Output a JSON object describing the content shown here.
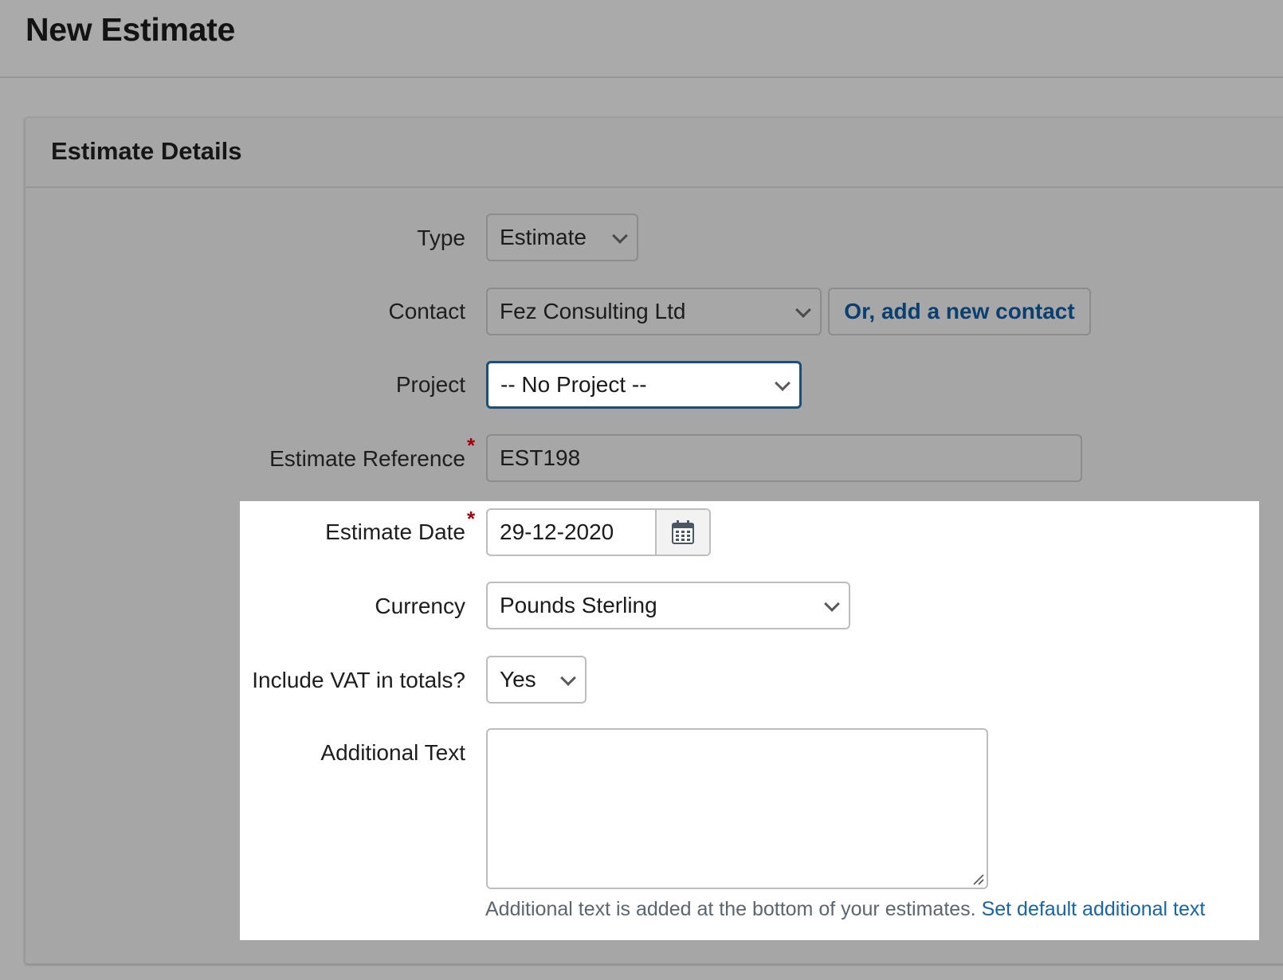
{
  "page": {
    "title": "New Estimate"
  },
  "panel": {
    "title": "Estimate Details"
  },
  "form": {
    "type": {
      "label": "Type",
      "value": "Estimate"
    },
    "contact": {
      "label": "Contact",
      "value": "Fez Consulting Ltd",
      "add_label": "Or, add a new contact"
    },
    "project": {
      "label": "Project",
      "value": "-- No Project --"
    },
    "reference": {
      "label": "Estimate Reference",
      "required": "*",
      "value": "EST198"
    },
    "date": {
      "label": "Estimate Date",
      "required": "*",
      "value": "29-12-2020"
    },
    "currency": {
      "label": "Currency",
      "value": "Pounds Sterling"
    },
    "vat": {
      "label": "Include VAT in totals?",
      "value": "Yes"
    },
    "additional_text": {
      "label": "Additional Text",
      "value": "",
      "help": "Additional text is added at the bottom of your estimates.",
      "help_link": "Set default additional text"
    }
  },
  "colors": {
    "accent": "#1b4f7a",
    "link": "#1565a8",
    "required": "#a8000b"
  },
  "icons": {
    "calendar": "calendar-icon",
    "chevron": "chevron-down-icon",
    "resize": "resize-handle-icon"
  }
}
